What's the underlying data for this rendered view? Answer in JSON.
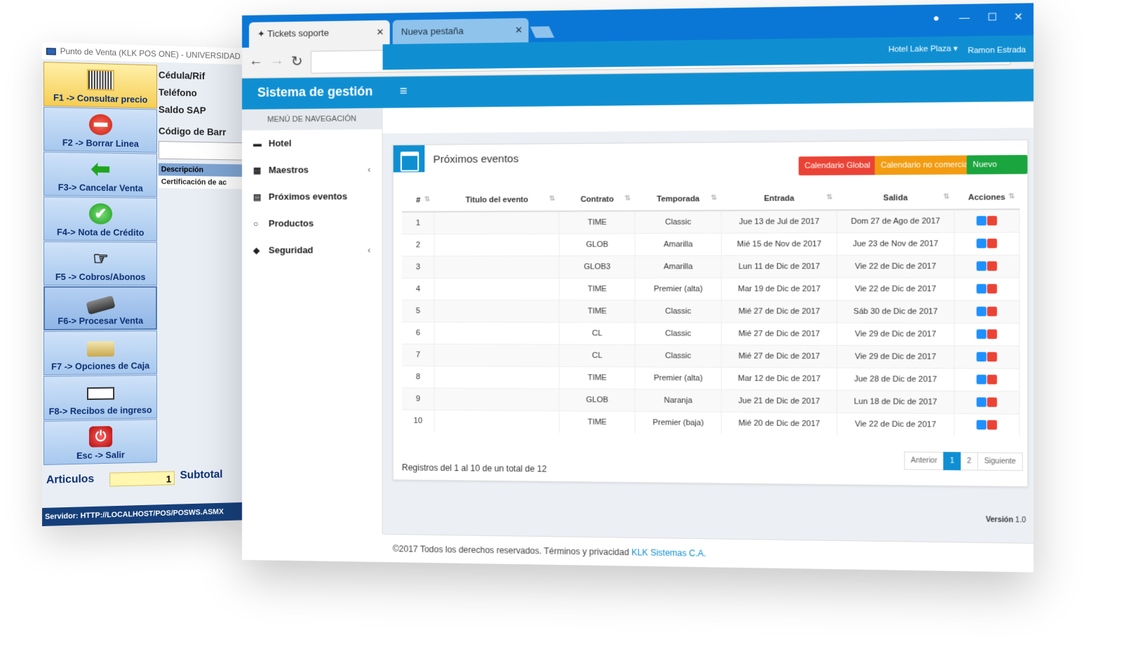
{
  "pos": {
    "window_title": "Punto de Venta (KLK POS ONE) - UNIVERSIDAD",
    "function_keys": [
      {
        "label": "F1 -> Consultar precio",
        "icon": "barcode-magnifier-icon"
      },
      {
        "label": "F2 -> Borrar Linea",
        "icon": "no-entry-icon"
      },
      {
        "label": "F3-> Cancelar Venta",
        "icon": "arrow-left-icon"
      },
      {
        "label": "F4-> Nota de Crédito",
        "icon": "checkmark-icon"
      },
      {
        "label": "F5 -> Cobros/Abonos",
        "icon": "hand-payment-icon"
      },
      {
        "label": "F6-> Procesar Venta",
        "icon": "card-terminal-icon"
      },
      {
        "label": "F7 -> Opciones de Caja",
        "icon": "cash-register-icon"
      },
      {
        "label": "F8-> Recibos de ingreso",
        "icon": "receipt-icon"
      },
      {
        "label": "Esc -> Salir",
        "icon": "power-icon"
      }
    ],
    "fields": {
      "cedula": "Cédula/Rif",
      "telefono": "Teléfono",
      "saldo": "Saldo SAP",
      "codigo": "Código de Barr",
      "col_descripcion": "Descripción",
      "row_1": "Certificación de ac"
    },
    "articulos_label": "Articulos",
    "articulos_value": "1",
    "subtotal_label": "Subtotal",
    "status": "Servidor: HTTP://LOCALHOST/POS/POSWS.ASMX"
  },
  "browser": {
    "tabs": [
      {
        "label": "Tickets soporte",
        "active": true
      },
      {
        "label": "Nueva pestaña",
        "active": false
      }
    ],
    "address": ""
  },
  "app": {
    "brand": "Sistema de gestión",
    "hotel": "Hotel Lake Plaza ▾",
    "user": "Ramon Estrada",
    "nav_header": "MENÚ DE NAVEGACIÓN",
    "nav_items": [
      {
        "label": "Hotel",
        "icon": "bed-icon"
      },
      {
        "label": "Maestros",
        "icon": "grid-icon"
      },
      {
        "label": "Próximos eventos",
        "icon": "calendar-icon"
      },
      {
        "label": "Productos",
        "icon": "circle-icon"
      },
      {
        "label": "Seguridad",
        "icon": "shield-icon"
      }
    ],
    "box_title": "Próximos eventos",
    "buttons": {
      "global": "Calendario Global",
      "no_comercial": "Calendario no comercial",
      "nuevo": "Nuevo evento"
    },
    "table": {
      "headers": [
        "#",
        "Titulo del evento",
        "Contrato",
        "Temporada",
        "Entrada",
        "Salida",
        "Acciones"
      ],
      "rows": [
        [
          "1",
          "",
          "TIME",
          "Classic",
          "Jue 13 de Jul de 2017",
          "Dom 27 de Ago de 2017"
        ],
        [
          "2",
          "",
          "GLOB",
          "Amarilla",
          "Mié 15 de Nov de 2017",
          "Jue 23 de Nov de 2017"
        ],
        [
          "3",
          "",
          "GLOB3",
          "Amarilla",
          "Lun 11 de Dic de 2017",
          "Vie 22 de Dic de 2017"
        ],
        [
          "4",
          "",
          "TIME",
          "Premier (alta)",
          "Mar 19 de Dic de 2017",
          "Vie 22 de Dic de 2017"
        ],
        [
          "5",
          "",
          "TIME",
          "Classic",
          "Mié 27 de Dic de 2017",
          "Sáb 30 de Dic de 2017"
        ],
        [
          "6",
          "",
          "CL",
          "Classic",
          "Mié 27 de Dic de 2017",
          "Vie 29 de Dic de 2017"
        ],
        [
          "7",
          "",
          "CL",
          "Classic",
          "Mié 27 de Dic de 2017",
          "Vie 29 de Dic de 2017"
        ],
        [
          "8",
          "",
          "TIME",
          "Premier (alta)",
          "Mar 12 de Dic de 2017",
          "Jue 28 de Dic de 2017"
        ],
        [
          "9",
          "",
          "GLOB",
          "Naranja",
          "Jue 21 de Dic de 2017",
          "Lun 18 de Dic de 2017"
        ],
        [
          "10",
          "",
          "TIME",
          "Premier (baja)",
          "Mié 20 de Dic de 2017",
          "Vie 22 de Dic de 2017"
        ]
      ]
    },
    "pager": {
      "prev": "Anterior",
      "pages": [
        "1",
        "2"
      ],
      "next": "Siguiente"
    },
    "records": "Registros del 1 al 10 de un total de 12",
    "version_label": "Versión",
    "version_value": "1.0",
    "footer_text": "©2017 Todos los derechos reservados. Términos y privacidad",
    "footer_brand": "KLK Sistemas C.A."
  }
}
